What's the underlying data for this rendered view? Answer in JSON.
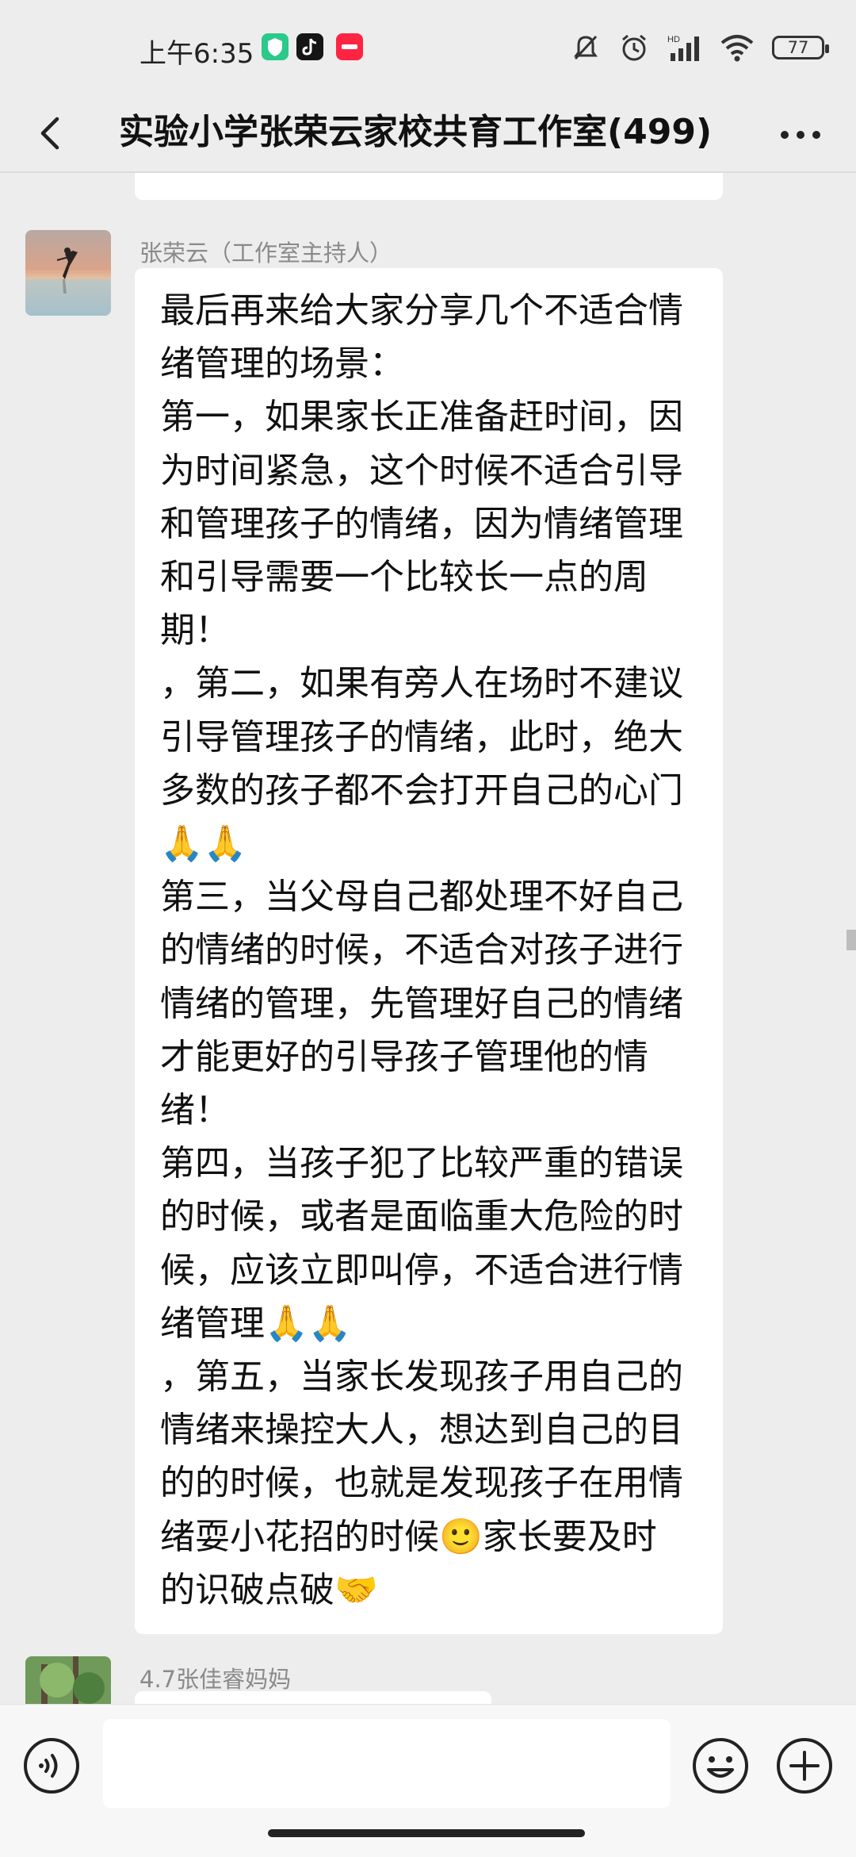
{
  "status_bar": {
    "time": "上午6:35",
    "app_icons": [
      "shield-app-icon",
      "tiktok-icon",
      "xiaohongshu-icon"
    ],
    "app_colors": [
      "#2bc98a",
      "#151515",
      "#ff2442"
    ],
    "battery": "77"
  },
  "header": {
    "title": "实验小学张荣云家校共育工作室(499)"
  },
  "messages": [
    {
      "sender": "张荣云（工作室主持人）",
      "avatar": "dancer-silhouette-avatar",
      "lines": [
        "最后再来给大家分享几个不适合情",
        "绪管理的场景：",
        "第一，如果家长正准备赶时间，因",
        "为时间紧急，这个时候不适合引导",
        "和管理孩子的情绪，因为情绪管理",
        "和引导需要一个比较长一点的周",
        "期！",
        "，第二，如果有旁人在场时不建议",
        "引导管理孩子的情绪，此时，绝大",
        "多数的孩子都不会打开自己的心门",
        "🙏🙏",
        "第三，当父母自己都处理不好自己",
        "的情绪的时候，不适合对孩子进行",
        "情绪的管理，先管理好自己的情绪",
        "才能更好的引导孩子管理他的情",
        "绪！",
        "第四，当孩子犯了比较严重的错误",
        "的时候，或者是面临重大危险的时",
        "候，应该立即叫停，不适合进行情",
        "绪管理🙏🙏",
        "，第五，当家长发现孩子用自己的",
        "情绪来操控大人，想达到自己的目",
        "的的时候，也就是发现孩子在用情",
        "绪耍小花招的时候🙂家长要及时",
        "的识破点破🤝"
      ]
    },
    {
      "sender": "4.7张佳睿妈妈",
      "avatar": "tree-avatar"
    }
  ],
  "input_bar": {
    "placeholder": ""
  }
}
